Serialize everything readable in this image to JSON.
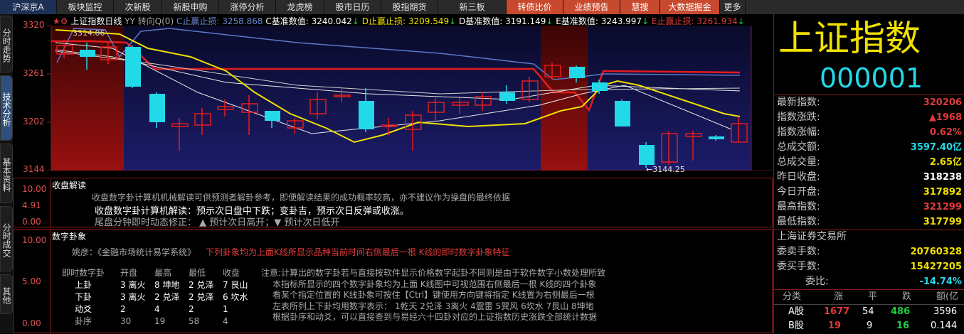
{
  "nav": {
    "items": [
      "沪深京A",
      "板块监控",
      "次新股",
      "新股申购",
      "涨停分析",
      "龙虎榜",
      "股市日历",
      "股指期货",
      "新三板",
      "转债比价",
      "业绩预告",
      "慧搜",
      "大数据掘金",
      "更多"
    ]
  },
  "side_tabs": [
    "分时走势",
    "技术分析",
    "基本资料",
    "分时成交",
    "其他"
  ],
  "chart": {
    "title": "上证指数日线",
    "legend": {
      "yy": "YY 转向Q(0)",
      "c_stop_label": "C止赢止损:",
      "c_stop": "3258.868",
      "c_base_label": "C基准数值:",
      "c_base": "3240.042",
      "d_stop_label": "D止赢止损:",
      "d_stop": "3209.549",
      "d_base_label": "D基准数值:",
      "d_base": "3191.149",
      "e_base_label": "E基准数值:",
      "e_base": "3243.997",
      "e_stop_label": "E止赢止损:",
      "e_stop": "3261.934"
    },
    "y_ticks": [
      "3320",
      "3261",
      "3202",
      "3144"
    ],
    "high_note": "3314.86",
    "low_note": "←3144.25"
  },
  "closing": {
    "title": "收盘解读",
    "axis": [
      "10.00",
      "4.91",
      "0.00"
    ],
    "desc": "收盘数字卦计算机机械解读可供预测者解卦参考，即便解读结果的成功概率较高，亦不建议作为操盘的最终依据",
    "main": "收盘数字卦计算机解读：预示次日盘中下跌；变卦吉，预示次日反弹或收涨。",
    "tail": "尾盘分钟即时动态修正： ▲ 预计次日高开；▼ 预计次日低开"
  },
  "gua": {
    "title": "数字卦象",
    "axis": [
      "10.00",
      "5.00",
      "0.00"
    ],
    "yao_label": "姚彦：《金融市场统计易学系统》",
    "yao_red": "下列卦象均为上面K线所显示品种当前时间右侧最后一根 K线的即时数字卦象特征",
    "table_header": [
      "即时数字卦",
      "开盘",
      "最高",
      "最低",
      "收盘"
    ],
    "rows": [
      {
        "name": "上卦",
        "c1": "3 离火",
        "c2": "8 坤地",
        "c3": "2 兑泽",
        "c4": "7 艮山"
      },
      {
        "name": "下卦",
        "c1": "3 离火",
        "c2": "2 兑泽",
        "c3": "2 兑泽",
        "c4": "6 坎水"
      },
      {
        "name": "动爻",
        "c1": "2",
        "c2": "4",
        "c3": "2",
        "c4": "1"
      },
      {
        "name": "卦序",
        "c1": "30",
        "c2": "19",
        "c3": "58",
        "c4": "4"
      }
    ],
    "notes": [
      "注意:计算出的数字卦若与直接按软件显示价格数字起卦不同则是由于软件数字小数处理所致",
      "本指标所显示的四个数字卦象均为上面 K线图中可视范围右侧最后一根 K线的四个卦象",
      "看某个指定位置的 K线卦象可按住【Ctrl】键使用方向键将指定 K线置为右侧最后一根",
      "左表所列上下卦均用数字表示： 1乾天 2兑泽 3离火 4震雷 5巽风 6坎水 7艮山 8坤地",
      "根据卦序和动爻，可以直接查到与易经六十四卦对应的上证指数历史涨跌全部统计数据"
    ]
  },
  "quote": {
    "name": "上证指数",
    "code": "000001",
    "rows": [
      {
        "label": "最新指数:",
        "value": "320206",
        "color": "#e23a3a"
      },
      {
        "label": "指数涨跌:",
        "value": "▲1968",
        "color": "#e23a3a"
      },
      {
        "label": "指数涨幅:",
        "value": "0.62%",
        "color": "#e23a3a"
      },
      {
        "label": "总成交额:",
        "value": "3597.40亿",
        "color": "#22d9e8"
      },
      {
        "label": "总成交量:",
        "value": "2.65亿",
        "color": "#f0e000"
      },
      {
        "label": "昨日收盘:",
        "value": "318238",
        "color": "#e6e6e6"
      },
      {
        "label": "今日开盘:",
        "value": "317892",
        "color": "#f0e000"
      },
      {
        "label": "最高指数:",
        "value": "321299",
        "color": "#e23a3a"
      },
      {
        "label": "最低指数:",
        "value": "317799",
        "color": "#f0e000"
      }
    ],
    "exchange": "上海证券交易所",
    "rows2": [
      {
        "label": "委卖手数:",
        "value": "20760328",
        "color": "#f0e000"
      },
      {
        "label": "委买手数:",
        "value": "15427205",
        "color": "#f0e000"
      },
      {
        "label": "委比:",
        "value": "-14.74%",
        "color": "#22d9e8"
      }
    ],
    "table_header": [
      "分类",
      "涨",
      "平",
      "跌",
      "额(亿"
    ],
    "table_rows": [
      {
        "name": "A股",
        "up": "1677",
        "flat": "54",
        "down": "486",
        "amt": "3596"
      },
      {
        "name": "B股",
        "up": "19",
        "flat": "9",
        "down": "16",
        "amt": "0.144"
      }
    ]
  },
  "colors": {
    "up": "#e23a3a",
    "down": "#22d9e8",
    "accent_red_bg": "#8a1010",
    "nav_highlight": "#c84a2e"
  }
}
